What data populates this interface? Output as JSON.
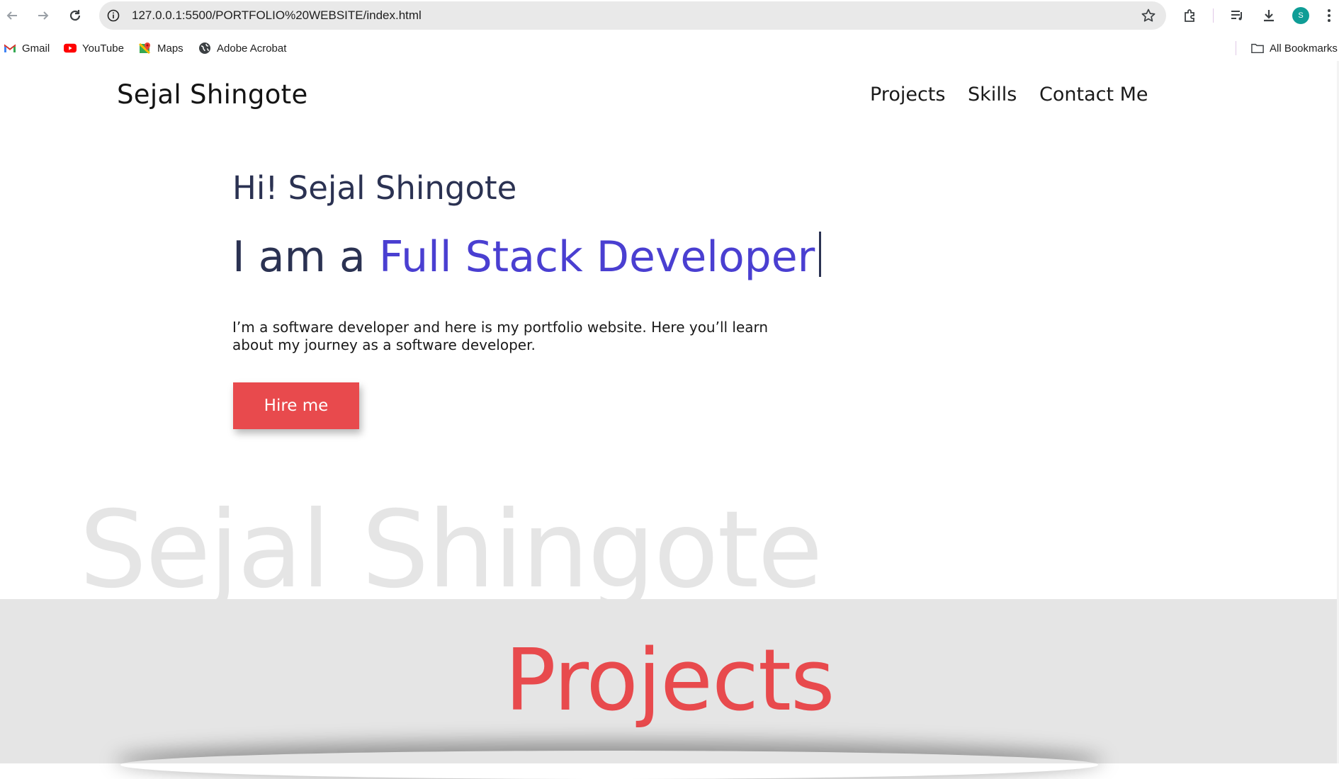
{
  "browser": {
    "url": "127.0.0.1:5500/PORTFOLIO%20WEBSITE/index.html",
    "avatar_letter": "S",
    "bookmarks": [
      {
        "label": "Gmail",
        "icon": "gmail-icon"
      },
      {
        "label": "YouTube",
        "icon": "youtube-icon"
      },
      {
        "label": "Maps",
        "icon": "maps-icon"
      },
      {
        "label": "Adobe Acrobat",
        "icon": "globe-icon"
      }
    ],
    "all_bookmarks_label": "All Bookmarks"
  },
  "nav": {
    "logo": "Sejal Shingote",
    "links": [
      "Projects",
      "Skills",
      "Contact Me"
    ]
  },
  "hero": {
    "greeting": "Hi! Sejal Shingote",
    "role_prefix": "I am a ",
    "role_highlight": "Full Stack Developer",
    "description": "I’m a software developer and here is my portfolio website. Here you’ll learn about my journey as a software developer.",
    "cta_label": "Hire me",
    "watermark": "Sejal Shingote"
  },
  "projects": {
    "title": "Projects"
  },
  "colors": {
    "accent_red": "#e84a4d",
    "accent_purple": "#4a3fd1",
    "heading_navy": "#2b3252",
    "section_gray": "#e5e5e5"
  }
}
